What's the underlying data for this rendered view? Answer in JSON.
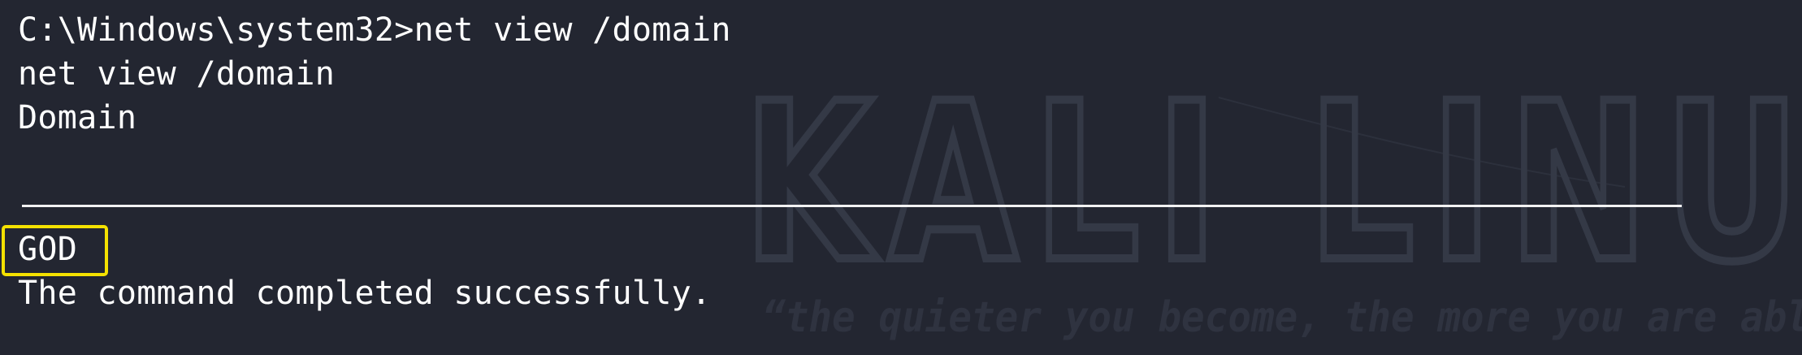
{
  "terminal": {
    "prompt_line": "C:\\Windows\\system32>net view /domain",
    "echo_line": "net view /domain",
    "header": "Domain",
    "domain_entry": "GOD",
    "status": "The command completed successfully."
  },
  "wallpaper": {
    "logo_text": "KALI LINU",
    "tagline": "“the quieter you become, the more you are abl"
  },
  "colors": {
    "background": "#232631",
    "text": "#ffffff",
    "highlight": "#f4e100",
    "watermark": "#333845"
  }
}
